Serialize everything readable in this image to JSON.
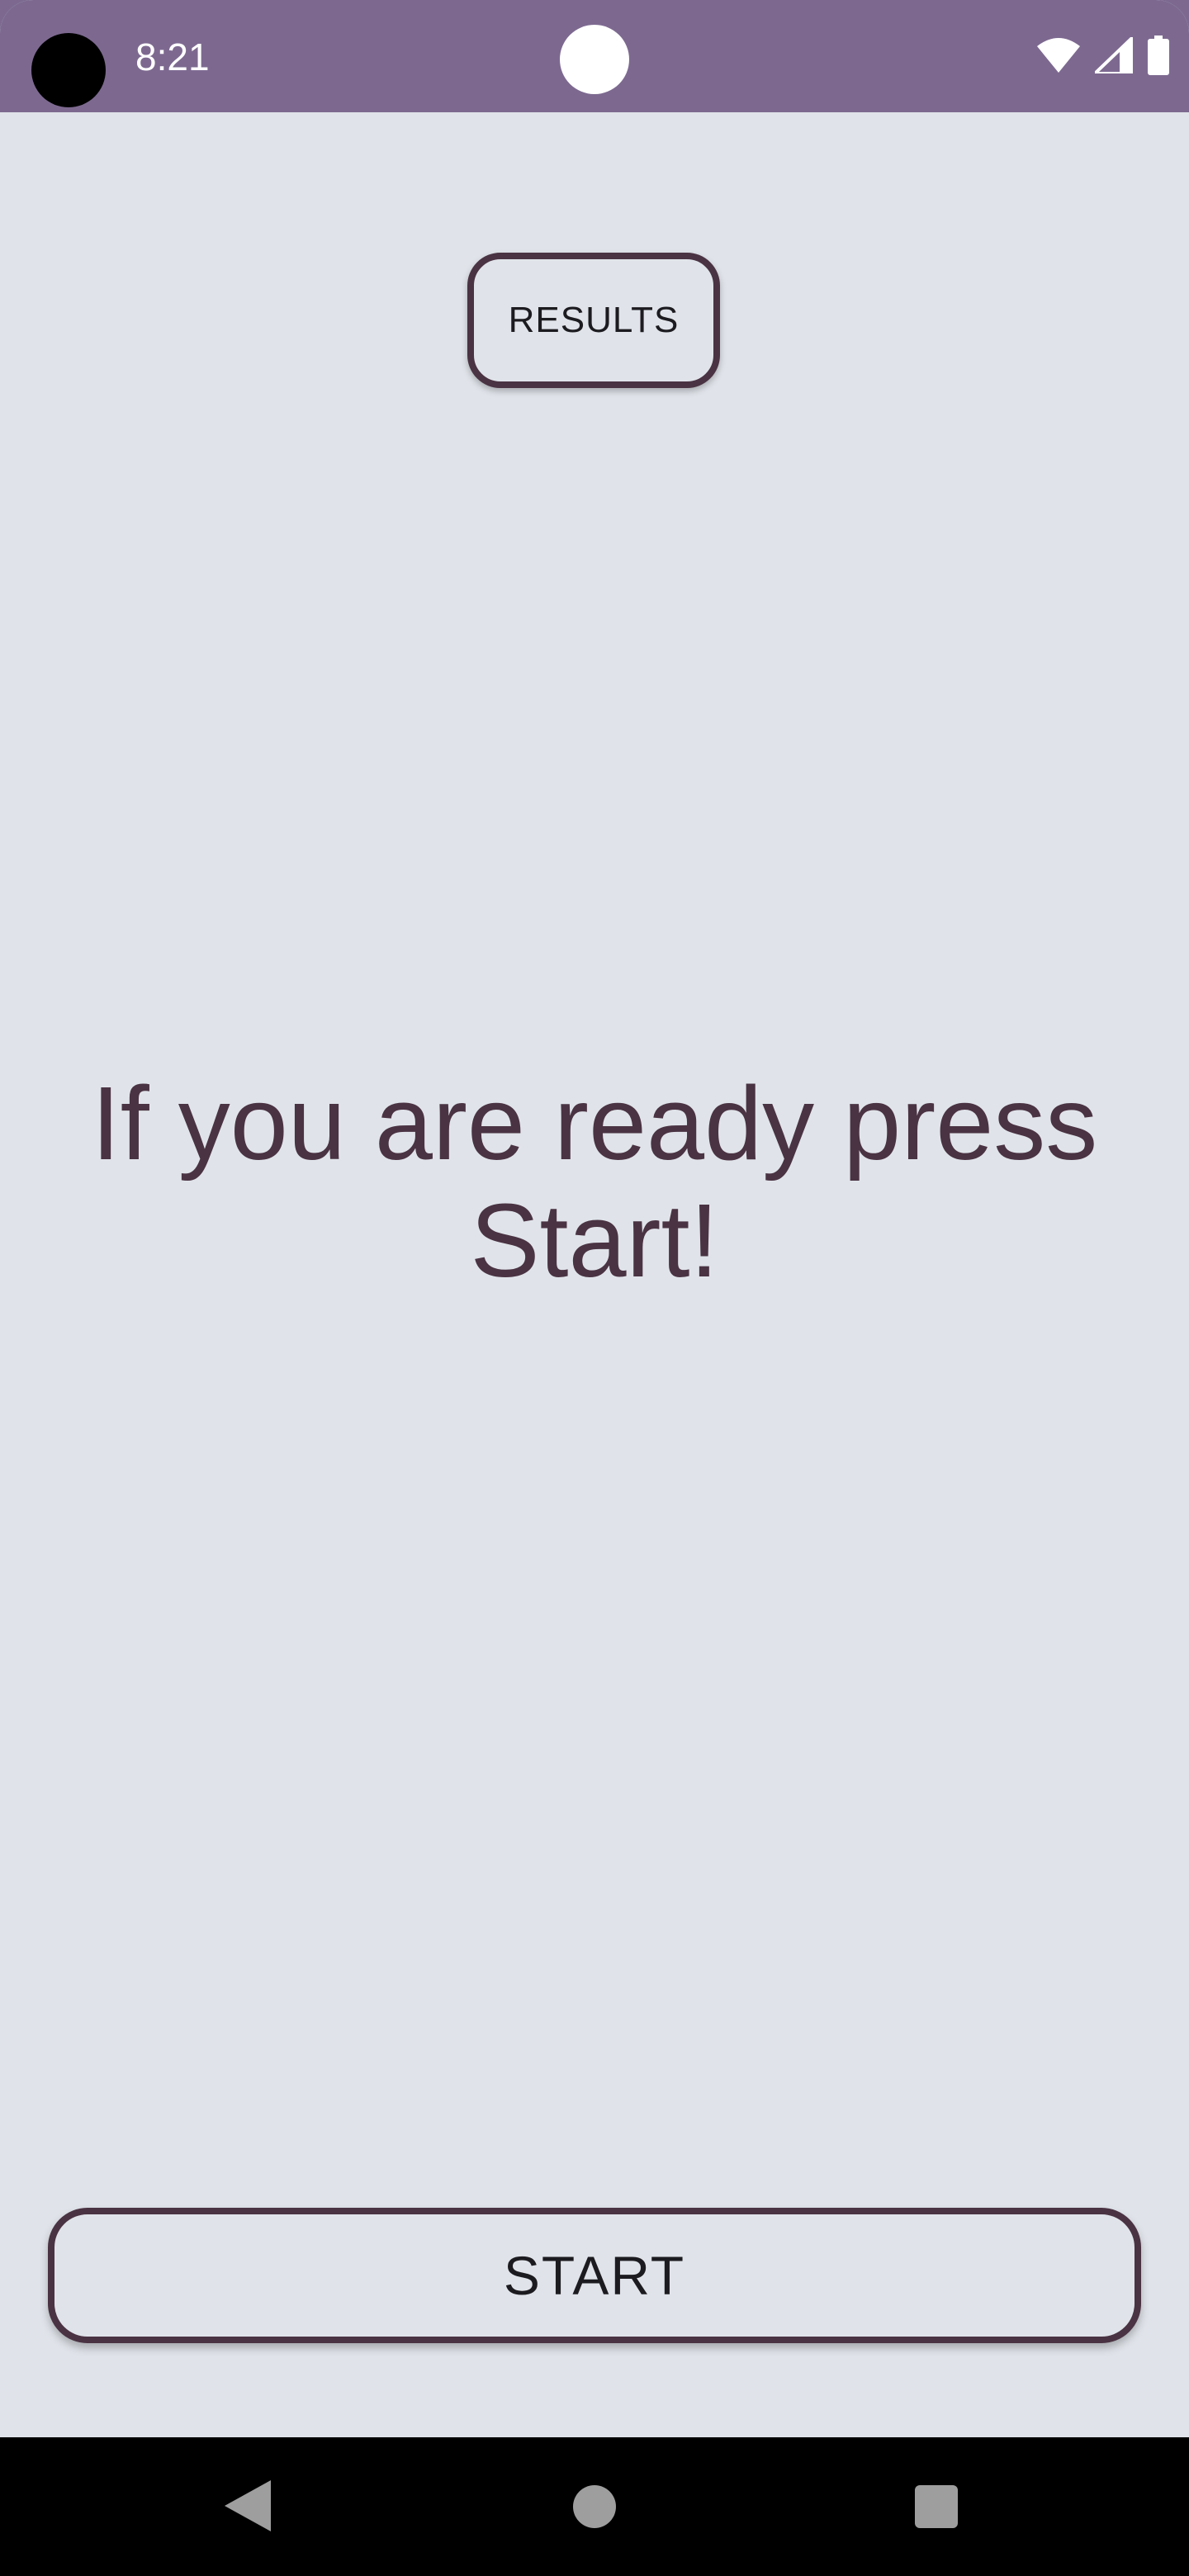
{
  "status_bar": {
    "time": "8:21",
    "icons": [
      "wifi-icon",
      "cell-signal-icon",
      "battery-icon"
    ],
    "background": "#7d6990"
  },
  "main": {
    "results_label": "RESULTS",
    "prompt": "If you are ready press Start!",
    "start_label": "START",
    "background": "#e0e4ea",
    "accent": "#4a3343"
  },
  "nav_bar": {
    "icons": [
      "back-icon",
      "home-icon",
      "recents-icon"
    ]
  }
}
